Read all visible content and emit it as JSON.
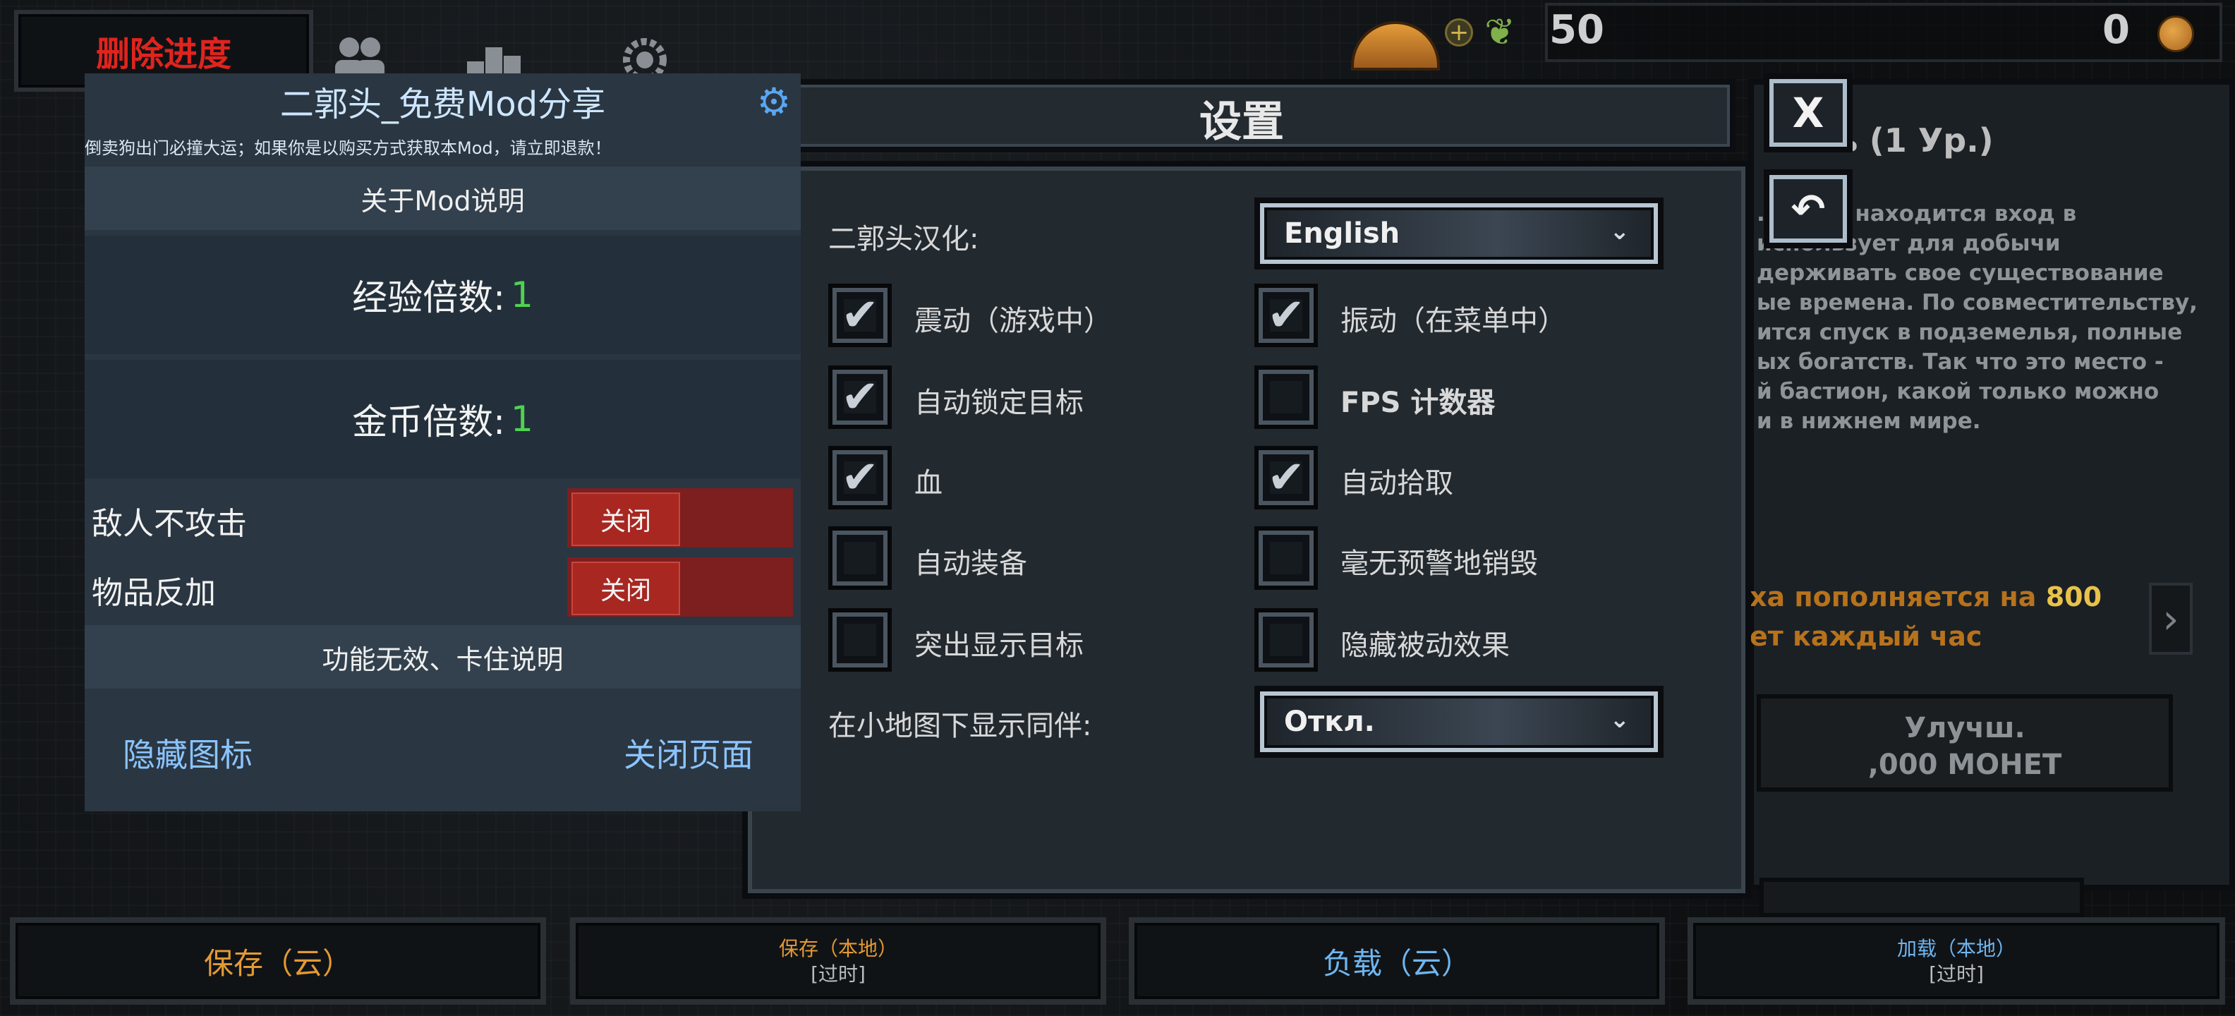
{
  "background": {
    "delete_progress": "删除进度",
    "resources_value": "50",
    "coins_value": "0",
    "account_hint": "帐户",
    "panel_title": "ть (1 Ур.)",
    "panel_description": ". Здесь находится вход в\nиспользует для добычи\nдерживать свое существование\nые времена. По совместительству,\nится спуск в подземелья, полные\nых богатств. Так что это место -\nй бастион, какой только можно\nи в нижнем мире.",
    "gold_line1": "ха пополняется на",
    "gold_amount": "800",
    "gold_line2": "ет каждый час",
    "upgrade_button": "Улучш.\n,000 МОНЕТ"
  },
  "bottom_bar": {
    "save_cloud": "保存（云）",
    "save_local": "保存（本地）",
    "save_local_sub": "[过时]",
    "load_cloud": "负载（云）",
    "load_local": "加载（本地）",
    "load_local_sub": "[过时]"
  },
  "settings": {
    "title": "设置",
    "close_icon": "X",
    "back_icon": "↶",
    "translation_label": "二郭头汉化:",
    "translation_value": "English",
    "companion_label": "在小地图下显示同伴:",
    "companion_value": "Откл.",
    "options": [
      {
        "label": "震动（游戏中）",
        "checked": true
      },
      {
        "label": "振动（在菜单中）",
        "checked": true
      },
      {
        "label": "自动锁定目标",
        "checked": true
      },
      {
        "label": "FPS 计数器",
        "checked": false
      },
      {
        "label": "血",
        "checked": true
      },
      {
        "label": "自动拾取",
        "checked": true
      },
      {
        "label": "自动装备",
        "checked": false
      },
      {
        "label": "毫无预警地销毁",
        "checked": false
      },
      {
        "label": "突出显示目标",
        "checked": false
      },
      {
        "label": "隐藏被动效果",
        "checked": false
      }
    ]
  },
  "mod_menu": {
    "title": "二郭头_免费Mod分享",
    "warning": "倒卖狗出门必撞大运；如果你是以购买方式获取本Mod，请立即退款！",
    "about_button": "关于Mod说明",
    "exp_label": "经验倍数:",
    "exp_value": "1",
    "gold_label": "金币倍数:",
    "gold_value": "1",
    "enemy_label": "敌人不攻击",
    "enemy_toggle": "关闭",
    "item_label": "物品反加",
    "item_toggle": "关闭",
    "help_button": "功能无效、卡住说明",
    "hide_icon": "隐藏图标",
    "close_page": "关闭页面"
  },
  "colors": {
    "accent_orange": "#e49a33",
    "accent_blue": "#6fb6ef",
    "delete_red": "#e0241e",
    "multiplier_green": "#4fd34f"
  }
}
